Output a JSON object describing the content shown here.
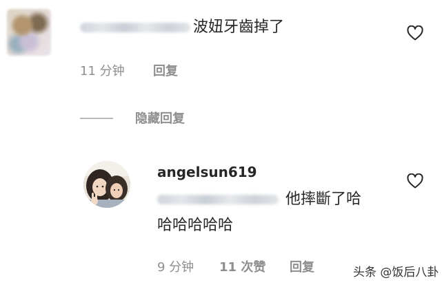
{
  "comment": {
    "text": "波妞牙齒掉了",
    "time": "11 分钟",
    "reply_label": "回复",
    "hide_replies_label": "隐藏回复"
  },
  "reply": {
    "username": "angelsun619",
    "text_line1": "他摔斷了哈",
    "text_line2": "哈哈哈哈哈",
    "time": "9 分钟",
    "likes": "11 次赞",
    "reply_label": "回复"
  },
  "watermark": "头条 @饭后八卦",
  "icons": {
    "like": "heart-outline-icon"
  },
  "colors": {
    "text": "#262626",
    "meta": "#8e8e8e"
  }
}
